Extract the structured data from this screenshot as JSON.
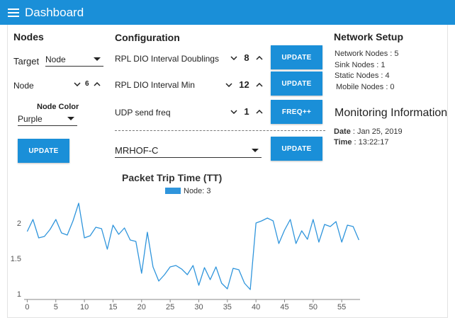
{
  "header": {
    "title": "Dashboard"
  },
  "nodes": {
    "title": "Nodes",
    "target_label": "Target",
    "target_value": "Node",
    "node_label": "Node",
    "node_value": "6",
    "color_label": "Node Color",
    "color_value": "Purple",
    "update_label": "UPDATE"
  },
  "configuration": {
    "title": "Configuration",
    "rows": [
      {
        "label": "RPL DIO Interval Doublings",
        "value": "8",
        "button": "UPDATE"
      },
      {
        "label": "RPL DIO Interval Min",
        "value": "12",
        "button": "UPDATE"
      },
      {
        "label": "UDP send freq",
        "value": "1",
        "button": "FREQ++"
      }
    ],
    "objective_function": "MRHOF-C",
    "of_button": "UPDATE"
  },
  "network": {
    "title": "Network Setup",
    "lines": [
      "Network Nodes : 5",
      "Sink Nodes : 1",
      "Static Nodes : 4",
      "Mobile Nodes : 0"
    ]
  },
  "monitoring": {
    "title": "Monitoring Information",
    "date_label": "Date",
    "date_value": " : Jan 25, 2019",
    "time_label": "Time",
    "time_value": " : 13:22:17"
  },
  "colors": {
    "accent": "#1a8fd8",
    "series": "#2f95dc"
  },
  "chart_data": {
    "type": "line",
    "title": "Packet Trip Time (TT)",
    "series": [
      {
        "name": "Node: 3",
        "x": [
          0,
          1,
          2,
          3,
          4,
          5,
          6,
          7,
          8,
          9,
          10,
          11,
          12,
          13,
          14,
          15,
          16,
          17,
          18,
          19,
          20,
          21,
          22,
          23,
          24,
          25,
          26,
          27,
          28,
          29,
          30,
          31,
          32,
          33,
          34,
          35,
          36,
          37,
          38,
          39,
          40,
          41,
          42,
          43,
          44,
          45,
          46,
          47,
          48,
          49,
          50,
          51,
          52,
          53,
          54,
          55,
          56,
          57,
          58
        ],
        "values": [
          1.88,
          2.05,
          1.79,
          1.81,
          1.91,
          2.05,
          1.86,
          1.83,
          2.03,
          2.28,
          1.79,
          1.82,
          1.94,
          1.92,
          1.63,
          1.97,
          1.84,
          1.93,
          1.76,
          1.74,
          1.29,
          1.87,
          1.38,
          1.18,
          1.27,
          1.38,
          1.4,
          1.35,
          1.27,
          1.4,
          1.12,
          1.37,
          1.2,
          1.38,
          1.15,
          1.07,
          1.36,
          1.34,
          1.15,
          1.06,
          2.0,
          2.03,
          2.07,
          2.03,
          1.71,
          1.9,
          2.05,
          1.71,
          1.89,
          1.77,
          2.05,
          1.73,
          1.98,
          1.95,
          2.02,
          1.73,
          1.97,
          1.95,
          1.76
        ]
      }
    ],
    "xticks": [
      0,
      5,
      10,
      15,
      20,
      25,
      30,
      35,
      40,
      45,
      50,
      55
    ],
    "yticks": [
      1,
      1.5,
      2
    ],
    "xlim": [
      -0.3,
      58.2
    ],
    "ylim": [
      0.95,
      2.37
    ],
    "legend": "top-center",
    "grid": false
  }
}
